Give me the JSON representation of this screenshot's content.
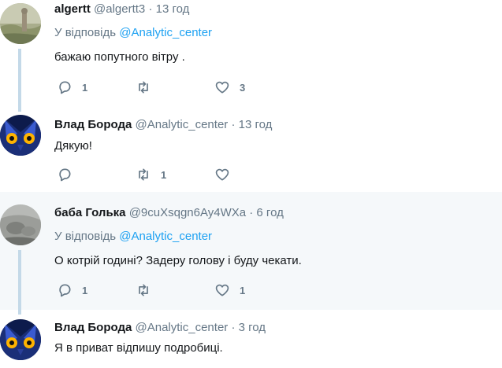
{
  "tweets": [
    {
      "name": "algertt",
      "handle": "@algertt3",
      "dot": "·",
      "time": "13 год",
      "reply_prefix": "У відповідь",
      "reply_mention": "@Analytic_center",
      "text": "бажаю попутного вітру .",
      "replies": "1",
      "retweets": "",
      "likes": "3",
      "avatar_icon": "landscape-photo-avatar"
    },
    {
      "name": "Влад Борода",
      "handle": "@Analytic_center",
      "dot": "·",
      "time": "13 год",
      "text": "Дякую!",
      "replies": "",
      "retweets": "1",
      "likes": "",
      "avatar_icon": "owl-eyes-avatar"
    },
    {
      "name": "баба Голька",
      "handle": "@9cuXsqgn6Ay4WXa",
      "dot": "·",
      "time": "6 год",
      "reply_prefix": "У відповідь",
      "reply_mention": "@Analytic_center",
      "text": "О котрій годині? Задеру голову і буду чекати.",
      "replies": "1",
      "retweets": "",
      "likes": "1",
      "avatar_icon": "grey-photo-avatar"
    },
    {
      "name": "Влад Борода",
      "handle": "@Analytic_center",
      "dot": "·",
      "time": "3 год",
      "text": "Я в приват відпишу подробиці.",
      "avatar_icon": "owl-eyes-avatar"
    }
  ],
  "colors": {
    "accent": "#1da1f2",
    "muted": "#657786",
    "thread_line": "#c4d9e8",
    "highlight_bg": "#f5f8fa"
  }
}
